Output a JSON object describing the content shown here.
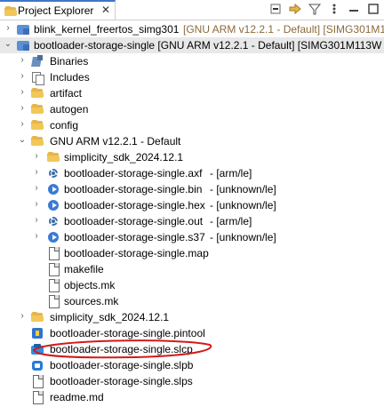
{
  "panel": {
    "title": "Project Explorer",
    "close_glyph": "✕"
  },
  "toolbar": {
    "buttons": [
      {
        "name": "collapse-all-icon"
      },
      {
        "name": "link-with-editor-icon"
      },
      {
        "name": "filter-icon"
      },
      {
        "name": "view-menu-icon"
      },
      {
        "name": "minimize-icon"
      },
      {
        "name": "maximize-icon"
      }
    ]
  },
  "tree": {
    "projects": [
      {
        "label": "blink_kernel_freertos_simg301",
        "suffix": "[GNU ARM v12.2.1 - Default] [SIMG301M1"
      },
      {
        "label": "bootloader-storage-single [GNU ARM v12.2.1 - Default] [SIMG301M113W"
      }
    ],
    "children": [
      {
        "label": "Binaries"
      },
      {
        "label": "Includes"
      },
      {
        "label": "artifact"
      },
      {
        "label": "autogen"
      },
      {
        "label": "config"
      },
      {
        "label": "GNU ARM v12.2.1 - Default"
      },
      {
        "label": "simplicity_sdk_2024.12.1"
      },
      {
        "label": "bootloader-storage-single.axf",
        "suffix": "- [arm/le]"
      },
      {
        "label": "bootloader-storage-single.bin",
        "suffix": "- [unknown/le]"
      },
      {
        "label": "bootloader-storage-single.hex",
        "suffix": "- [unknown/le]"
      },
      {
        "label": "bootloader-storage-single.out",
        "suffix": "- [arm/le]"
      },
      {
        "label": "bootloader-storage-single.s37",
        "suffix": "- [unknown/le]"
      },
      {
        "label": "bootloader-storage-single.map"
      },
      {
        "label": "makefile"
      },
      {
        "label": "objects.mk"
      },
      {
        "label": "sources.mk"
      },
      {
        "label": "simplicity_sdk_2024.12.1"
      },
      {
        "label": "bootloader-storage-single.pintool"
      },
      {
        "label": "bootloader-storage-single.slcp"
      },
      {
        "label": "bootloader-storage-single.slpb"
      },
      {
        "label": "bootloader-storage-single.slps"
      },
      {
        "label": "readme.md"
      }
    ]
  },
  "colors": {
    "selected_row": "#e8e8e8",
    "annotation": "#d11a1a",
    "tab_accent": "#3f76c9",
    "muted_text": "#8a6b3b"
  }
}
